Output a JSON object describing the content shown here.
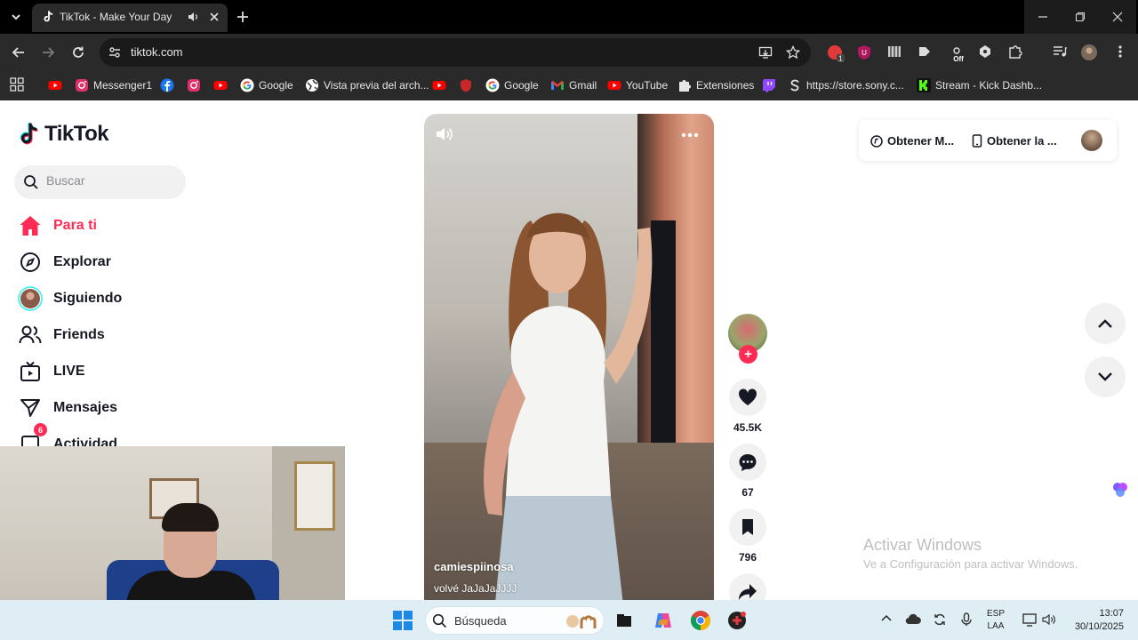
{
  "browser": {
    "tab_title": "TikTok - Make Your Day",
    "url": "tiktok.com",
    "bookmarks": [
      {
        "label": "",
        "icon": "youtube-icon"
      },
      {
        "label": "Messenger1",
        "icon": "instagram-icon"
      },
      {
        "label": "",
        "icon": "facebook-icon"
      },
      {
        "label": "",
        "icon": "instagram-icon"
      },
      {
        "label": "",
        "icon": "youtube-icon"
      },
      {
        "label": "Google",
        "icon": "google-icon"
      },
      {
        "label": "Vista previa del arch...",
        "icon": "globe-icon"
      },
      {
        "label": "",
        "icon": "youtube-icon"
      },
      {
        "label": "",
        "icon": "red-shield-icon"
      },
      {
        "label": "Google",
        "icon": "google-icon"
      },
      {
        "label": "Gmail",
        "icon": "gmail-icon"
      },
      {
        "label": "YouTube",
        "icon": "youtube-icon"
      },
      {
        "label": "Extensiones",
        "icon": "puzzle-icon"
      },
      {
        "label": "",
        "icon": "twitch-icon"
      },
      {
        "label": "https://store.sony.c...",
        "icon": "sony-icon"
      },
      {
        "label": "Stream - Kick Dashb...",
        "icon": "kick-icon"
      }
    ],
    "extension_badge": "1",
    "extension_off_label": "Off"
  },
  "tiktok": {
    "logo_text": "TikTok",
    "search_placeholder": "Buscar",
    "nav": [
      {
        "label": "Para ti",
        "icon": "home-icon",
        "active": true
      },
      {
        "label": "Explorar",
        "icon": "compass-icon"
      },
      {
        "label": "Siguiendo",
        "icon": "following-avatar-icon"
      },
      {
        "label": "Friends",
        "icon": "friends-icon"
      },
      {
        "label": "LIVE",
        "icon": "live-icon"
      },
      {
        "label": "Mensajes",
        "icon": "messages-icon"
      },
      {
        "label": "Actividad",
        "icon": "activity-icon",
        "badge": "6"
      }
    ],
    "video": {
      "username": "camiespiinosa",
      "caption": "volvé JaJaJaJJJJ"
    },
    "actions": {
      "likes": "45.5K",
      "comments": "67",
      "saves": "796"
    },
    "top_right": {
      "get_coins": "Obtener M...",
      "get_app": "Obtener la ..."
    },
    "accent": "#fe2c55"
  },
  "windows": {
    "watermark_title": "Activar Windows",
    "watermark_sub": "Ve a Configuración para activar Windows.",
    "taskbar_search": "Búsqueda",
    "lang_1": "ESP",
    "lang_2": "LAA",
    "time": "13:07",
    "date": "30/10/2025"
  }
}
